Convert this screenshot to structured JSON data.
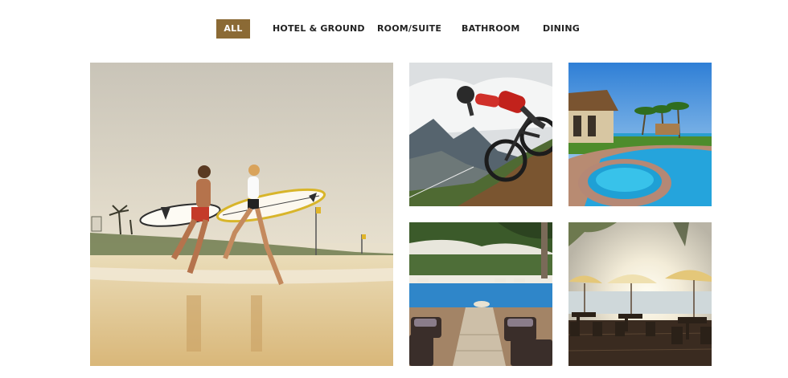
{
  "filters": [
    {
      "label": "ALL",
      "active": true
    },
    {
      "label": "HOTEL & GROUND",
      "active": false
    },
    {
      "label": "ROOM/SUITE",
      "active": false
    },
    {
      "label": "BATHROOM",
      "active": false
    },
    {
      "label": "DINING",
      "active": false
    }
  ],
  "accent_color": "#8b6a35",
  "gallery": [
    {
      "subject": "surfers-running-on-beach"
    },
    {
      "subject": "mountain-biker"
    },
    {
      "subject": "resort-pool-with-palms"
    },
    {
      "subject": "resort-pool-deck-with-loungers"
    },
    {
      "subject": "beach-dining-under-umbrellas"
    }
  ]
}
